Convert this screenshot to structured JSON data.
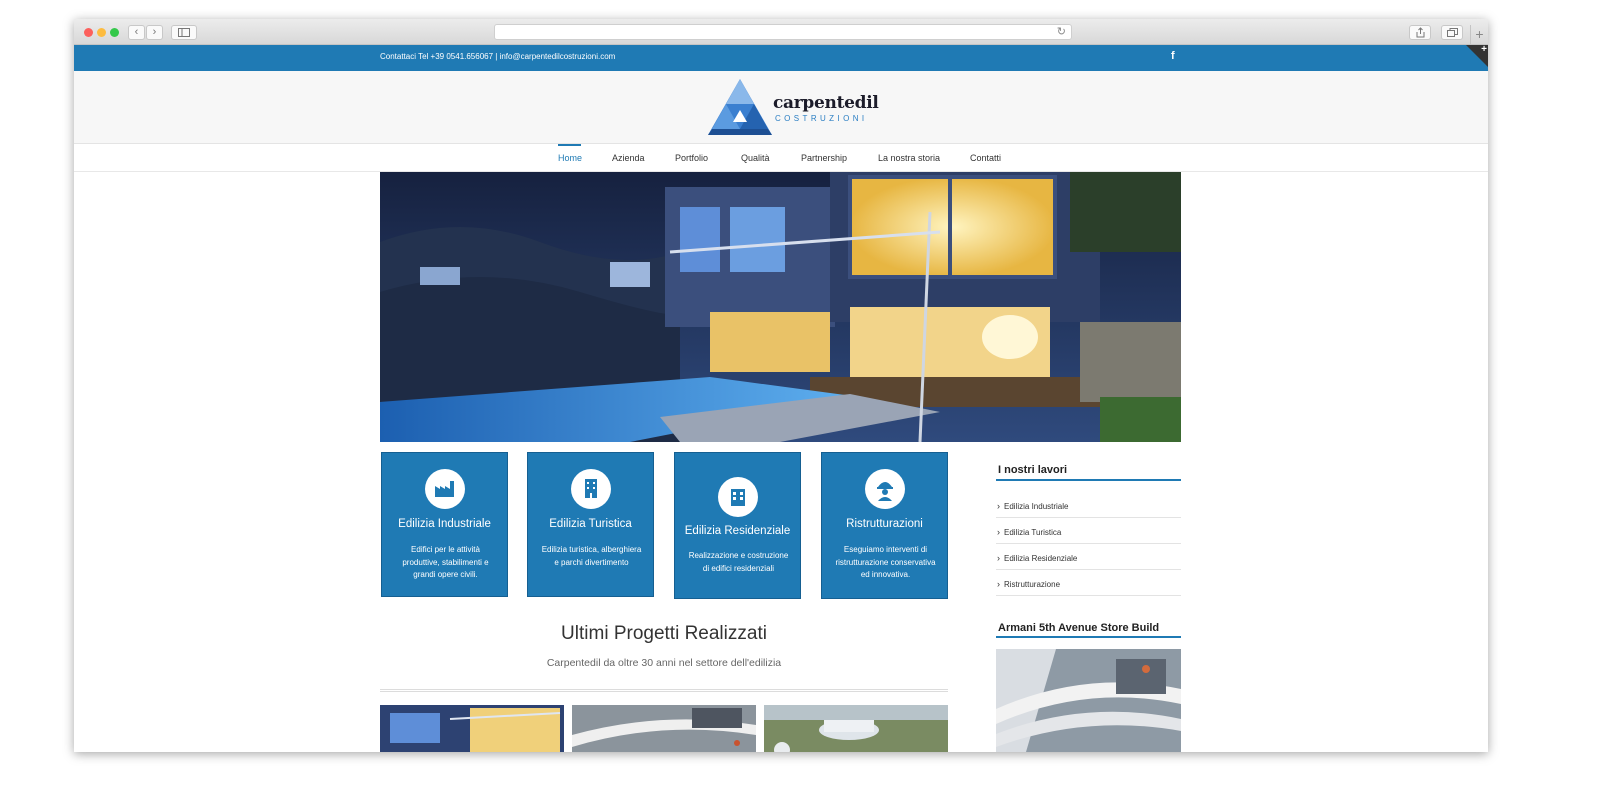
{
  "topbar": {
    "contact_text": "Contattaci Tel +39 0541.656067  |  info@carpentedilcostruzioni.com",
    "facebook_icon_label": "f",
    "corner_plus": "+"
  },
  "logo": {
    "name": "carpentedil",
    "subtitle": "COSTRUZIONI"
  },
  "nav": {
    "items": [
      "Home",
      "Azienda",
      "Portfolio",
      "Qualità",
      "Partnership",
      "La nostra storia",
      "Contatti"
    ]
  },
  "cards": [
    {
      "title": "Edilizia Industriale",
      "desc": "Edifici per le attività produttive, stabilimenti e grandi opere civili.",
      "icon": "factory-icon"
    },
    {
      "title": "Edilizia Turistica",
      "desc": "Edilizia turistica, alberghiera e parchi divertimento",
      "icon": "hotel-building-icon"
    },
    {
      "title": "Edilizia Residenziale",
      "desc": "Realizzazione e costruzione di edifici residenziali",
      "icon": "apartment-building-icon"
    },
    {
      "title": "Ristrutturazioni",
      "desc": "Eseguiamo interventi di ristrutturazione conservativa ed innovativa.",
      "icon": "construction-worker-icon"
    }
  ],
  "sidebar": {
    "works_title": "I nostri lavori",
    "works": [
      "Edilizia Industriale",
      "Edilizia Turistica",
      "Edilizia Residenziale",
      "Ristrutturazione"
    ],
    "project_title": "Armani 5th Avenue Store Build"
  },
  "projects": {
    "title": "Ultimi Progetti Realizzati",
    "subtitle": "Carpentedil da oltre 30 anni nel settore dell'edilizia"
  },
  "colors": {
    "brand": "#1f7ab4",
    "brand_dark": "#155f91"
  }
}
